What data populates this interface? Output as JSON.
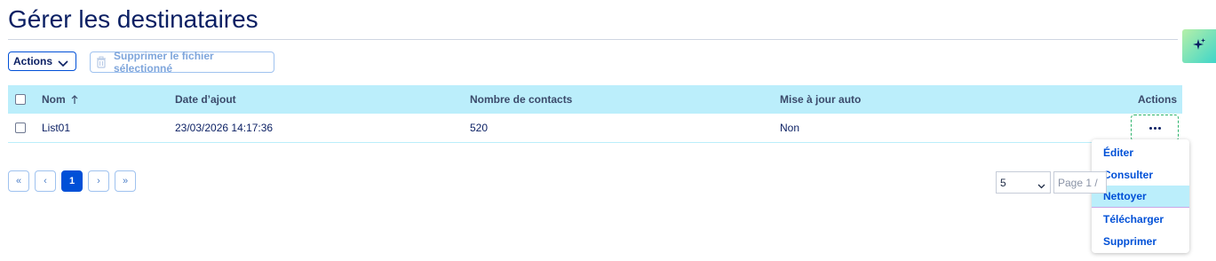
{
  "page": {
    "title": "Gérer les destinataires"
  },
  "toolbar": {
    "actions_label": "Actions",
    "delete_label": "Supprimer le fichier sélectionné"
  },
  "table": {
    "columns": {
      "name": "Nom",
      "date": "Date d’ajout",
      "contacts": "Nombre de contacts",
      "auto_update": "Mise à jour auto",
      "actions": "Actions"
    },
    "rows": [
      {
        "name": "List01",
        "date": "23/03/2026 14:17:36",
        "contacts": "520",
        "auto_update": "Non"
      }
    ]
  },
  "row_menu": {
    "items": [
      {
        "label": "Éditer"
      },
      {
        "label": "Consulter"
      },
      {
        "label": "Nettoyer"
      },
      {
        "label": "Télécharger"
      },
      {
        "label": "Supprimer"
      }
    ],
    "active_item": "Nettoyer"
  },
  "pagination": {
    "first": "«",
    "prev": "‹",
    "current": "1",
    "next": "›",
    "last": "»",
    "page_size": "5",
    "page_indicator": "Page 1 /"
  },
  "icons": {
    "magic": "sparkles-icon",
    "sort": "arrow-up-icon",
    "delete": "trash-icon",
    "more": "more-horizontal-icon"
  },
  "colors": {
    "accent": "#0050d7",
    "title": "#0a1f63",
    "table_header_bg": "#bbeefb"
  }
}
